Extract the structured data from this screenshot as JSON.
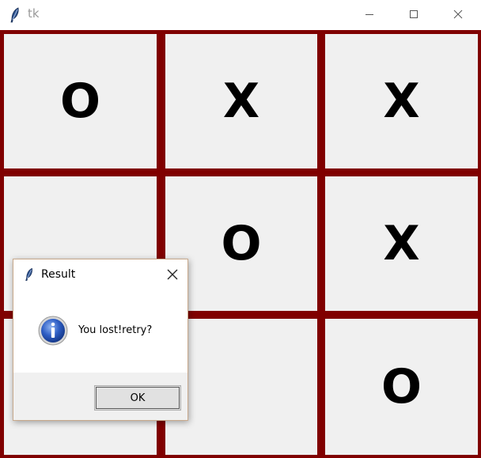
{
  "window": {
    "title": "tk",
    "icon": "tk-feather-icon"
  },
  "board": {
    "line_color": "#800000",
    "cell_color": "#f0f0f0",
    "cells": [
      [
        "O",
        "X",
        "X"
      ],
      [
        "",
        "O",
        "X"
      ],
      [
        "",
        "",
        "O"
      ]
    ]
  },
  "dialog": {
    "title": "Result",
    "icon": "info-icon",
    "message": "You lost!retry?",
    "ok_label": "OK"
  }
}
